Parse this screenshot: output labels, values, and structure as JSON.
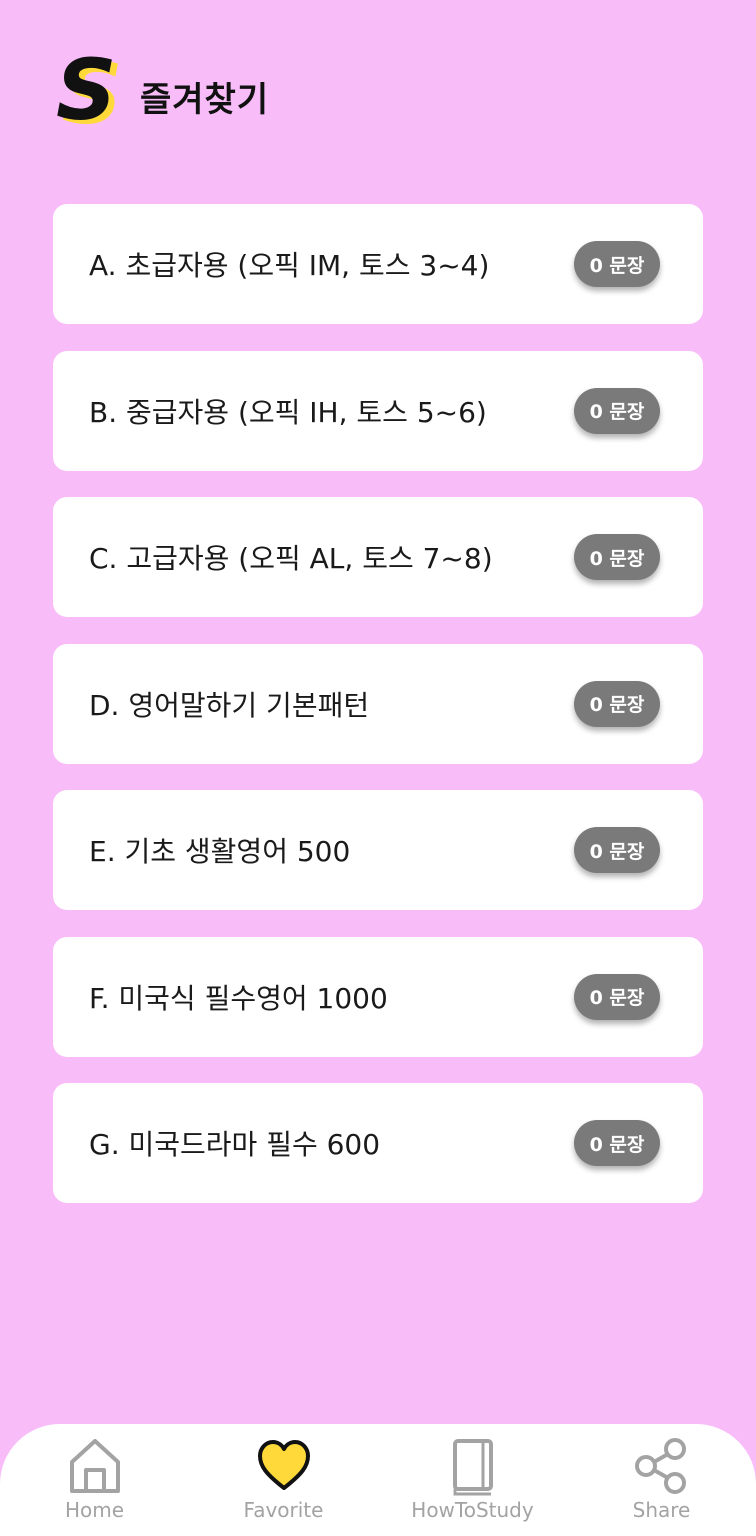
{
  "header": {
    "logo_letter": "S",
    "title": "즐겨찾기"
  },
  "categories": [
    {
      "label": "A. 초급자용 (오픽 IM, 토스 3~4)",
      "count": "0 문장"
    },
    {
      "label": "B. 중급자용 (오픽 IH, 토스 5~6)",
      "count": "0 문장"
    },
    {
      "label": "C. 고급자용 (오픽 AL, 토스 7~8)",
      "count": "0 문장"
    },
    {
      "label": "D. 영어말하기 기본패턴",
      "count": "0 문장"
    },
    {
      "label": "E. 기초 생활영어 500",
      "count": "0 문장"
    },
    {
      "label": "F. 미국식 필수영어 1000",
      "count": "0 문장"
    },
    {
      "label": "G. 미국드라마 필수 600",
      "count": "0 문장"
    }
  ],
  "nav": {
    "items": [
      {
        "label": "Home",
        "icon": "home-icon"
      },
      {
        "label": "Favorite",
        "icon": "heart-icon",
        "active": true
      },
      {
        "label": "HowToStudy",
        "icon": "book-icon"
      },
      {
        "label": "Share",
        "icon": "share-icon"
      }
    ]
  },
  "colors": {
    "background": "#f8bdf8",
    "card": "#ffffff",
    "badge": "#7a7a7a",
    "logo_accent": "#ffd93a",
    "heart_fill": "#ffd93a",
    "nav_inactive": "#a3a3a3"
  }
}
